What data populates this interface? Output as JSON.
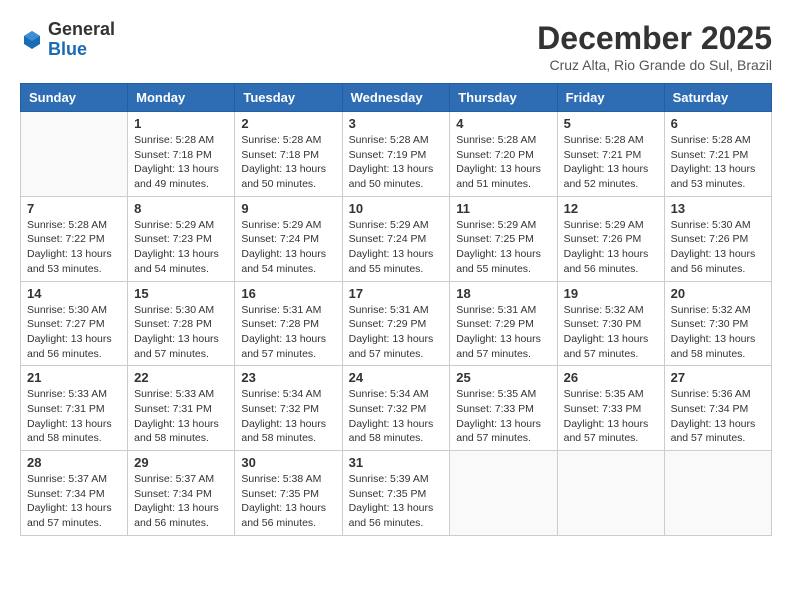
{
  "logo": {
    "general": "General",
    "blue": "Blue"
  },
  "title": "December 2025",
  "location": "Cruz Alta, Rio Grande do Sul, Brazil",
  "days_header": [
    "Sunday",
    "Monday",
    "Tuesday",
    "Wednesday",
    "Thursday",
    "Friday",
    "Saturday"
  ],
  "weeks": [
    [
      {
        "day": "",
        "info": ""
      },
      {
        "day": "1",
        "info": "Sunrise: 5:28 AM\nSunset: 7:18 PM\nDaylight: 13 hours\nand 49 minutes."
      },
      {
        "day": "2",
        "info": "Sunrise: 5:28 AM\nSunset: 7:18 PM\nDaylight: 13 hours\nand 50 minutes."
      },
      {
        "day": "3",
        "info": "Sunrise: 5:28 AM\nSunset: 7:19 PM\nDaylight: 13 hours\nand 50 minutes."
      },
      {
        "day": "4",
        "info": "Sunrise: 5:28 AM\nSunset: 7:20 PM\nDaylight: 13 hours\nand 51 minutes."
      },
      {
        "day": "5",
        "info": "Sunrise: 5:28 AM\nSunset: 7:21 PM\nDaylight: 13 hours\nand 52 minutes."
      },
      {
        "day": "6",
        "info": "Sunrise: 5:28 AM\nSunset: 7:21 PM\nDaylight: 13 hours\nand 53 minutes."
      }
    ],
    [
      {
        "day": "7",
        "info": "Sunrise: 5:28 AM\nSunset: 7:22 PM\nDaylight: 13 hours\nand 53 minutes."
      },
      {
        "day": "8",
        "info": "Sunrise: 5:29 AM\nSunset: 7:23 PM\nDaylight: 13 hours\nand 54 minutes."
      },
      {
        "day": "9",
        "info": "Sunrise: 5:29 AM\nSunset: 7:24 PM\nDaylight: 13 hours\nand 54 minutes."
      },
      {
        "day": "10",
        "info": "Sunrise: 5:29 AM\nSunset: 7:24 PM\nDaylight: 13 hours\nand 55 minutes."
      },
      {
        "day": "11",
        "info": "Sunrise: 5:29 AM\nSunset: 7:25 PM\nDaylight: 13 hours\nand 55 minutes."
      },
      {
        "day": "12",
        "info": "Sunrise: 5:29 AM\nSunset: 7:26 PM\nDaylight: 13 hours\nand 56 minutes."
      },
      {
        "day": "13",
        "info": "Sunrise: 5:30 AM\nSunset: 7:26 PM\nDaylight: 13 hours\nand 56 minutes."
      }
    ],
    [
      {
        "day": "14",
        "info": "Sunrise: 5:30 AM\nSunset: 7:27 PM\nDaylight: 13 hours\nand 56 minutes."
      },
      {
        "day": "15",
        "info": "Sunrise: 5:30 AM\nSunset: 7:28 PM\nDaylight: 13 hours\nand 57 minutes."
      },
      {
        "day": "16",
        "info": "Sunrise: 5:31 AM\nSunset: 7:28 PM\nDaylight: 13 hours\nand 57 minutes."
      },
      {
        "day": "17",
        "info": "Sunrise: 5:31 AM\nSunset: 7:29 PM\nDaylight: 13 hours\nand 57 minutes."
      },
      {
        "day": "18",
        "info": "Sunrise: 5:31 AM\nSunset: 7:29 PM\nDaylight: 13 hours\nand 57 minutes."
      },
      {
        "day": "19",
        "info": "Sunrise: 5:32 AM\nSunset: 7:30 PM\nDaylight: 13 hours\nand 57 minutes."
      },
      {
        "day": "20",
        "info": "Sunrise: 5:32 AM\nSunset: 7:30 PM\nDaylight: 13 hours\nand 58 minutes."
      }
    ],
    [
      {
        "day": "21",
        "info": "Sunrise: 5:33 AM\nSunset: 7:31 PM\nDaylight: 13 hours\nand 58 minutes."
      },
      {
        "day": "22",
        "info": "Sunrise: 5:33 AM\nSunset: 7:31 PM\nDaylight: 13 hours\nand 58 minutes."
      },
      {
        "day": "23",
        "info": "Sunrise: 5:34 AM\nSunset: 7:32 PM\nDaylight: 13 hours\nand 58 minutes."
      },
      {
        "day": "24",
        "info": "Sunrise: 5:34 AM\nSunset: 7:32 PM\nDaylight: 13 hours\nand 58 minutes."
      },
      {
        "day": "25",
        "info": "Sunrise: 5:35 AM\nSunset: 7:33 PM\nDaylight: 13 hours\nand 57 minutes."
      },
      {
        "day": "26",
        "info": "Sunrise: 5:35 AM\nSunset: 7:33 PM\nDaylight: 13 hours\nand 57 minutes."
      },
      {
        "day": "27",
        "info": "Sunrise: 5:36 AM\nSunset: 7:34 PM\nDaylight: 13 hours\nand 57 minutes."
      }
    ],
    [
      {
        "day": "28",
        "info": "Sunrise: 5:37 AM\nSunset: 7:34 PM\nDaylight: 13 hours\nand 57 minutes."
      },
      {
        "day": "29",
        "info": "Sunrise: 5:37 AM\nSunset: 7:34 PM\nDaylight: 13 hours\nand 56 minutes."
      },
      {
        "day": "30",
        "info": "Sunrise: 5:38 AM\nSunset: 7:35 PM\nDaylight: 13 hours\nand 56 minutes."
      },
      {
        "day": "31",
        "info": "Sunrise: 5:39 AM\nSunset: 7:35 PM\nDaylight: 13 hours\nand 56 minutes."
      },
      {
        "day": "",
        "info": ""
      },
      {
        "day": "",
        "info": ""
      },
      {
        "day": "",
        "info": ""
      }
    ]
  ]
}
